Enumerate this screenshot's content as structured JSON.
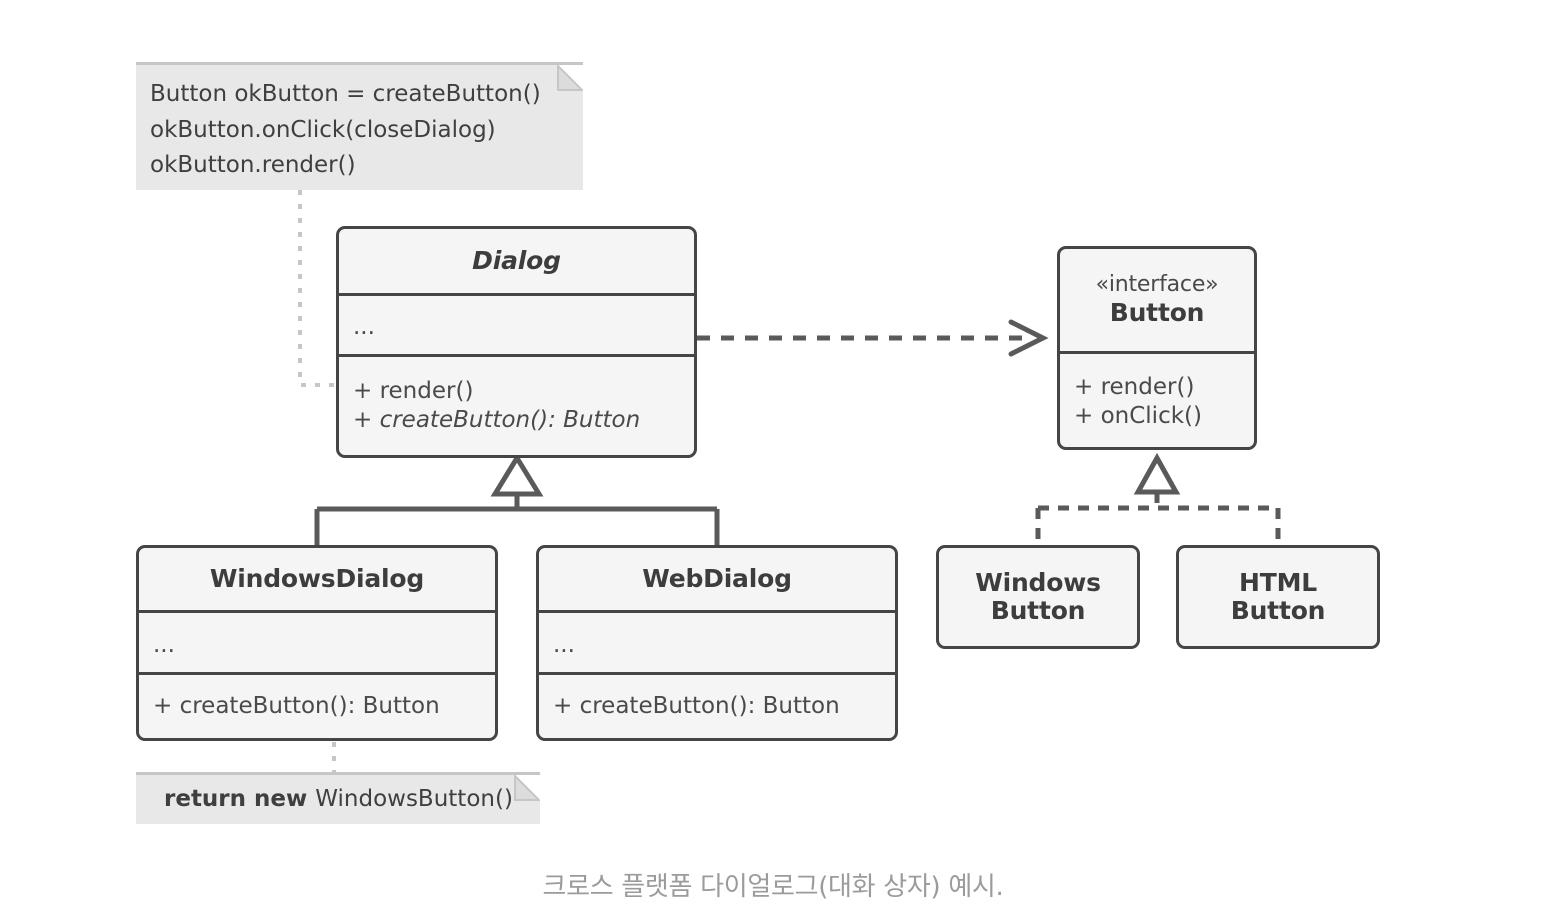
{
  "colors": {
    "page_background": "#ffffff",
    "class_fill": "#f5f5f5",
    "class_border": "#454545",
    "note_fill": "#e8e8e8",
    "note_border": "#c6c6c6",
    "connector": "#5a5a5a",
    "note_connector": "#c6c6c6",
    "caption_text": "#9b9b9b",
    "text": "#3d3d3d"
  },
  "diagram": {
    "title": "크로스 플랫폼 다이얼로그(대화 상자) 예시.",
    "notes": [
      {
        "id": "note-dialog-usage",
        "lines": [
          "Button okButton = createButton()",
          "okButton.onClick(closeDialog)",
          "okButton.render()"
        ]
      },
      {
        "id": "note-windowsdialog-return",
        "bold_prefix": "return new ",
        "rest": "WindowsButton()"
      }
    ],
    "classes": {
      "dialog": {
        "name": "Dialog",
        "abstract": true,
        "attributes": [
          "..."
        ],
        "operations": [
          "+ render()",
          "+ createButton(): Button"
        ]
      },
      "button_interface": {
        "stereotype": "«interface»",
        "name": "Button",
        "operations": [
          "+ render()",
          "+ onClick()"
        ]
      },
      "windows_dialog": {
        "name": "WindowsDialog",
        "attributes": [
          "..."
        ],
        "operations": [
          "+ createButton(): Button"
        ]
      },
      "web_dialog": {
        "name": "WebDialog",
        "attributes": [
          "..."
        ],
        "operations": [
          "+ createButton(): Button"
        ]
      },
      "windows_button": {
        "name_line1": "Windows",
        "name_line2": "Button"
      },
      "html_button": {
        "name_line1": "HTML",
        "name_line2": "Button"
      }
    },
    "relations": [
      {
        "id": "dialog-uses-button",
        "type": "dependency",
        "from": "Dialog",
        "to": "Button",
        "style": "dashed-open-arrow"
      },
      {
        "id": "windowsdialog-extends-dialog",
        "type": "generalization",
        "from": "WindowsDialog",
        "to": "Dialog",
        "style": "solid-hollow-triangle"
      },
      {
        "id": "webdialog-extends-dialog",
        "type": "generalization",
        "from": "WebDialog",
        "to": "Dialog",
        "style": "solid-hollow-triangle"
      },
      {
        "id": "windowsbutton-implements-button",
        "type": "realization",
        "from": "WindowsButton",
        "to": "Button",
        "style": "dashed-hollow-triangle"
      },
      {
        "id": "htmlbutton-implements-button",
        "type": "realization",
        "from": "HTMLButton",
        "to": "Button",
        "style": "dashed-hollow-triangle"
      }
    ]
  }
}
